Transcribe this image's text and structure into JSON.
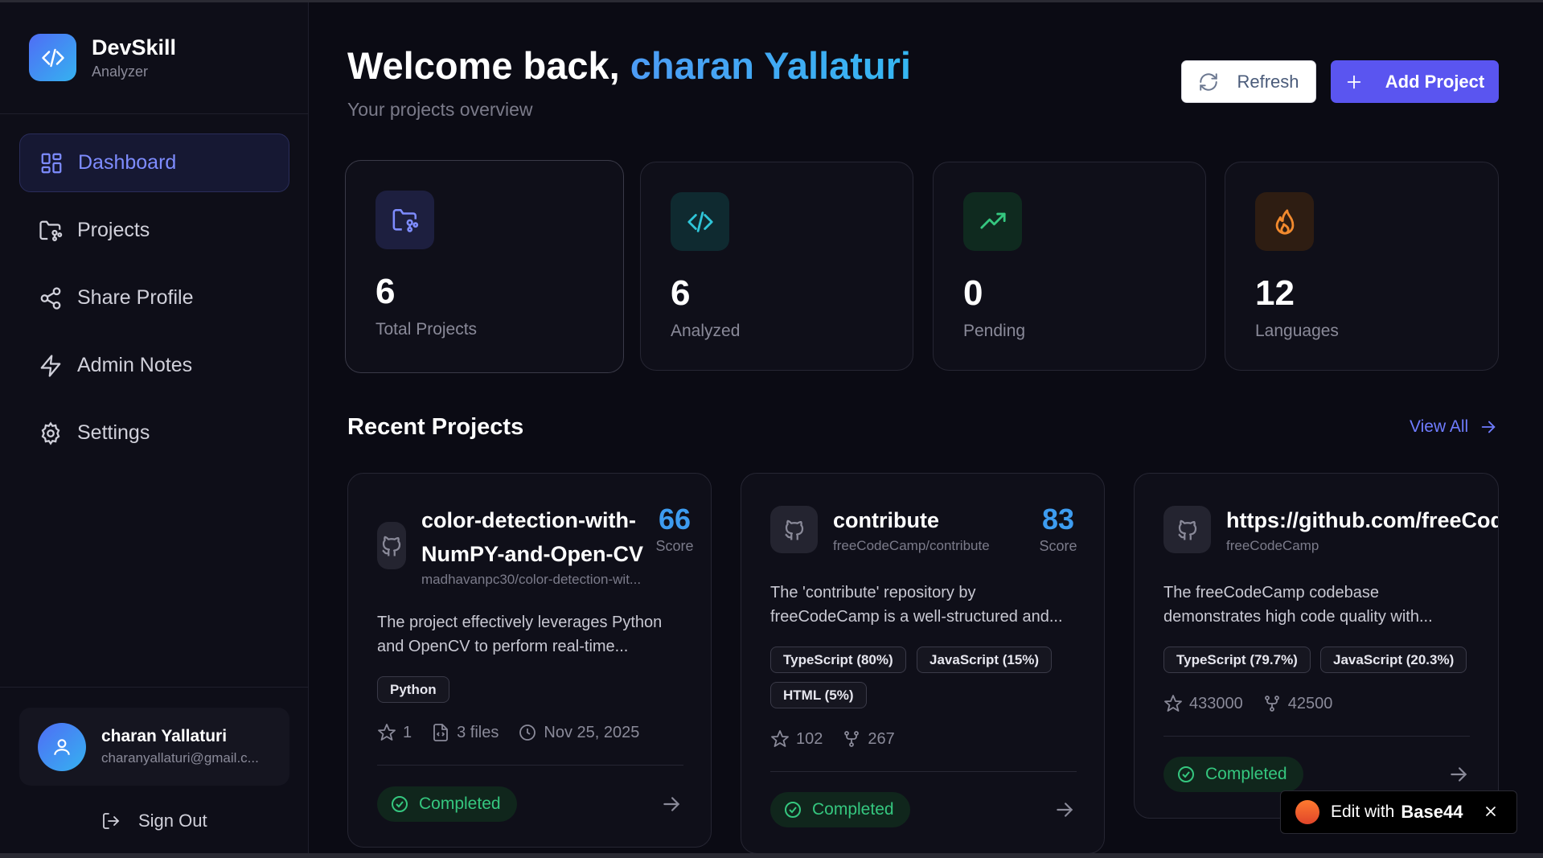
{
  "brand": {
    "title": "DevSkill",
    "subtitle": "Analyzer"
  },
  "nav": [
    {
      "label": "Dashboard",
      "icon": "layout-grid-icon",
      "active": true
    },
    {
      "label": "Projects",
      "icon": "folder-git-icon"
    },
    {
      "label": "Share Profile",
      "icon": "share-icon"
    },
    {
      "label": "Admin Notes",
      "icon": "bolt-icon"
    },
    {
      "label": "Settings",
      "icon": "gear-icon"
    }
  ],
  "user": {
    "name": "charan Yallaturi",
    "email": "charanyallaturi@gmail.c..."
  },
  "signout": "Sign Out",
  "header": {
    "welcome": "Welcome back,",
    "user_name": "charan Yallaturi",
    "subtitle": "Your projects overview",
    "refresh": "Refresh",
    "add_project": "Add Project"
  },
  "stats": [
    {
      "value": "6",
      "label": "Total Projects",
      "icon": "folder-git-icon",
      "color": "#7e8cff"
    },
    {
      "value": "6",
      "label": "Analyzed",
      "icon": "code-icon",
      "color": "#2fc5d8"
    },
    {
      "value": "0",
      "label": "Pending",
      "icon": "trending-up-icon",
      "color": "#35c77f"
    },
    {
      "value": "12",
      "label": "Languages",
      "icon": "flame-icon",
      "color": "#f28a2e"
    }
  ],
  "recent": {
    "title": "Recent Projects",
    "view_all": "View All"
  },
  "projects": [
    {
      "title_line1": "color-detection-with-",
      "title_line2": "NumPY-and-Open-CV",
      "repo": "madhavanpc30/color-detection-wit...",
      "score": "66",
      "score_label": "Score",
      "desc1": "The project effectively leverages Python",
      "desc2": "and OpenCV to perform real-time...",
      "tags": [
        "Python"
      ],
      "stars": "1",
      "files": "3 files",
      "date": "Nov 25, 2025",
      "status": "Completed"
    },
    {
      "title": "contribute",
      "repo": "freeCodeCamp/contribute",
      "score": "83",
      "score_label": "Score",
      "desc1": "The 'contribute' repository by",
      "desc2": "freeCodeCamp is a well-structured and...",
      "tags": [
        "TypeScript (80%)",
        "JavaScript (15%)",
        "HTML (5%)"
      ],
      "stars": "102",
      "forks": "267",
      "status": "Completed"
    },
    {
      "title": "https://github.com/freeCodeCa",
      "repo": "freeCodeCamp",
      "desc1": "The freeCodeCamp codebase",
      "desc2": "demonstrates high code quality with...",
      "tags": [
        "TypeScript (79.7%)",
        "JavaScript (20.3%)"
      ],
      "stars": "433000",
      "forks": "42500",
      "status": "Completed"
    }
  ],
  "base44": {
    "text": "Edit with",
    "brand": "Base44"
  },
  "colors": {
    "accent": "#5a55f0",
    "score": "#3d9cf0",
    "success": "#35c77f",
    "background": "#0b0b14"
  }
}
